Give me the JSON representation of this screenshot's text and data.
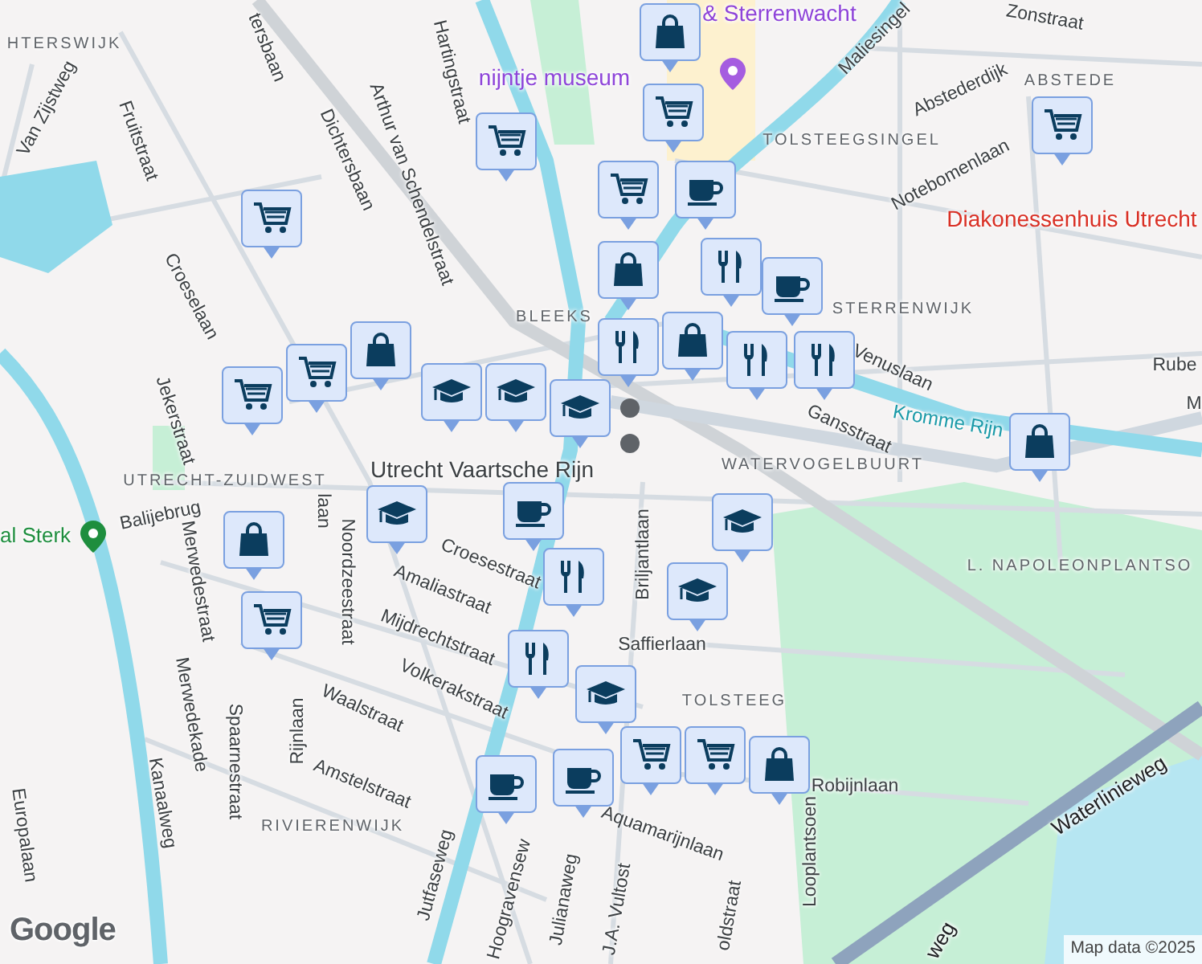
{
  "map": {
    "labels": [
      {
        "text": "HTERSWIJK",
        "kind": "district"
      },
      {
        "text": "Van Zijstweg",
        "kind": "street"
      },
      {
        "text": "Fruitstraat",
        "kind": "street"
      },
      {
        "text": "Croeselaan",
        "kind": "street"
      },
      {
        "text": "tersbaan",
        "kind": "street"
      },
      {
        "text": "Dichtersbaan",
        "kind": "street"
      },
      {
        "text": "Hartingstraat",
        "kind": "street"
      },
      {
        "text": "Arthur van Schendelstraat",
        "kind": "street"
      },
      {
        "text": "BLEEKS",
        "kind": "district"
      },
      {
        "text": "Jekerstraat",
        "kind": "street"
      },
      {
        "text": "UTRECHT-ZUIDWEST",
        "kind": "district"
      },
      {
        "text": "Utrecht Vaartsche Rijn",
        "kind": "station"
      },
      {
        "text": "Balijebrug",
        "kind": "street"
      },
      {
        "text": "al Sterk",
        "kind": "park"
      },
      {
        "text": "Merwedestraat",
        "kind": "street"
      },
      {
        "text": "laan",
        "kind": "street"
      },
      {
        "text": "Noordzeestraat",
        "kind": "street"
      },
      {
        "text": "Croesestraat",
        "kind": "street"
      },
      {
        "text": "Amaliastraat",
        "kind": "street"
      },
      {
        "text": "Mijdrechtstraat",
        "kind": "street"
      },
      {
        "text": "Volkerakstraat",
        "kind": "street"
      },
      {
        "text": "Waalstraat",
        "kind": "street"
      },
      {
        "text": "Merwedekade",
        "kind": "street"
      },
      {
        "text": "Spaarnestraat",
        "kind": "street"
      },
      {
        "text": "Rijnlaan",
        "kind": "street"
      },
      {
        "text": "Kanaalweg",
        "kind": "street"
      },
      {
        "text": "Amstelstraat",
        "kind": "street"
      },
      {
        "text": "RIVIERENWIJK",
        "kind": "district"
      },
      {
        "text": "Europalaan",
        "kind": "street"
      },
      {
        "text": "Jutfaseweg",
        "kind": "street"
      },
      {
        "text": "Hoogravensew",
        "kind": "street"
      },
      {
        "text": "Julianaweg",
        "kind": "street"
      },
      {
        "text": "J.A. Vultost",
        "kind": "street"
      },
      {
        "text": "Briljantlaan",
        "kind": "street"
      },
      {
        "text": "Saffierlaan",
        "kind": "street"
      },
      {
        "text": "TOLSTEEG",
        "kind": "district"
      },
      {
        "text": "Robijnlaan",
        "kind": "street"
      },
      {
        "text": "Aquamarijnlaan",
        "kind": "street"
      },
      {
        "text": "Looplantsoen",
        "kind": "street"
      },
      {
        "text": "oldstraat",
        "kind": "street"
      },
      {
        "text": "Waterlinieweg",
        "kind": "highway"
      },
      {
        "text": "weg",
        "kind": "highway"
      },
      {
        "text": "L. NAPOLEONPLANTSO",
        "kind": "district"
      },
      {
        "text": "WATERVOGELBUURT",
        "kind": "district"
      },
      {
        "text": "Gansstraat",
        "kind": "street"
      },
      {
        "text": "Venuslaan",
        "kind": "street"
      },
      {
        "text": "Kromme Rijn",
        "kind": "water"
      },
      {
        "text": "Rube",
        "kind": "street"
      },
      {
        "text": "M",
        "kind": "street"
      },
      {
        "text": "STERRENWIJK",
        "kind": "district"
      },
      {
        "text": "Diakonessenhuis Utrecht",
        "kind": "hospital"
      },
      {
        "text": "Notebomenlaan",
        "kind": "street"
      },
      {
        "text": "TOLSTEEGSINGEL",
        "kind": "district"
      },
      {
        "text": "Abstederdijk",
        "kind": "street"
      },
      {
        "text": "ABSTEDE",
        "kind": "district"
      },
      {
        "text": "Maliesingel",
        "kind": "street"
      },
      {
        "text": "Zonstraat",
        "kind": "street"
      },
      {
        "text": "nijntje museum",
        "kind": "museum"
      },
      {
        "text": "& Sterrenwacht",
        "kind": "museum"
      }
    ],
    "markers": [
      {
        "kind": "cart"
      },
      {
        "kind": "cart"
      },
      {
        "kind": "bag"
      },
      {
        "kind": "cart"
      },
      {
        "kind": "cart"
      },
      {
        "kind": "school"
      },
      {
        "kind": "school"
      },
      {
        "kind": "school"
      },
      {
        "kind": "bag"
      },
      {
        "kind": "cart"
      },
      {
        "kind": "cart"
      },
      {
        "kind": "cup"
      },
      {
        "kind": "bag"
      },
      {
        "kind": "cutlery"
      },
      {
        "kind": "cup"
      },
      {
        "kind": "cutlery"
      },
      {
        "kind": "bag"
      },
      {
        "kind": "cutlery"
      },
      {
        "kind": "cutlery"
      },
      {
        "kind": "school"
      },
      {
        "kind": "cup"
      },
      {
        "kind": "cutlery"
      },
      {
        "kind": "cutlery"
      },
      {
        "kind": "school"
      },
      {
        "kind": "cup"
      },
      {
        "kind": "cup"
      },
      {
        "kind": "bag"
      },
      {
        "kind": "cart"
      },
      {
        "kind": "school"
      },
      {
        "kind": "school"
      },
      {
        "kind": "cart"
      },
      {
        "kind": "cart"
      },
      {
        "kind": "bag"
      },
      {
        "kind": "cart"
      },
      {
        "kind": "bag"
      }
    ],
    "logo": "Google",
    "attribution": "Map data ©2025"
  }
}
